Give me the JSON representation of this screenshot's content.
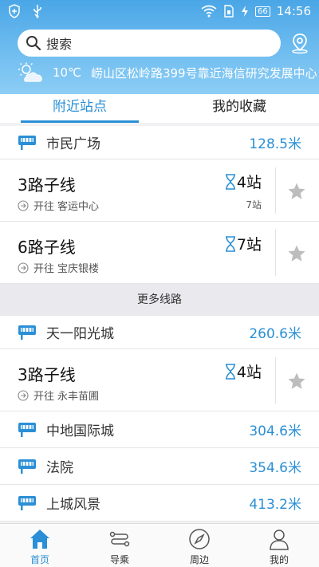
{
  "status_bar": {
    "battery": "66",
    "time": "14:56"
  },
  "search": {
    "placeholder": "搜索"
  },
  "weather": {
    "temperature": "10℃",
    "location": "崂山区松岭路399号靠近海信研究发展中心"
  },
  "tabs": [
    {
      "label": "附近站点",
      "active": true
    },
    {
      "label": "我的收藏",
      "active": false
    }
  ],
  "stations": [
    {
      "name": "市民广场",
      "distance": "128.5米",
      "routes": [
        {
          "name": "3路子线",
          "stops": "4站",
          "direction_label": "开往",
          "destination": "客运中心",
          "sub": "7站"
        },
        {
          "name": "6路子线",
          "stops": "7站",
          "direction_label": "开往",
          "destination": "宝庆银楼",
          "sub": ""
        }
      ]
    }
  ],
  "more_label": "更多线路",
  "stations2": [
    {
      "name": "天一阳光城",
      "distance": "260.6米",
      "routes": [
        {
          "name": "3路子线",
          "stops": "4站",
          "direction_label": "开往",
          "destination": "永丰苗圃",
          "sub": ""
        }
      ]
    },
    {
      "name": "中地国际城",
      "distance": "304.6米"
    },
    {
      "name": "法院",
      "distance": "354.6米"
    },
    {
      "name": "上城风景",
      "distance": "413.2米"
    }
  ],
  "bottom_nav": [
    {
      "label": "首页",
      "icon": "home-icon",
      "active": true
    },
    {
      "label": "导乘",
      "icon": "route-icon",
      "active": false
    },
    {
      "label": "周边",
      "icon": "compass-icon",
      "active": false
    },
    {
      "label": "我的",
      "icon": "user-icon",
      "active": false
    }
  ],
  "colors": {
    "accent": "#2a8fd6",
    "header_top": "#4aa6e6",
    "header_bottom": "#8ccdf5",
    "star": "#bdbdbd"
  }
}
